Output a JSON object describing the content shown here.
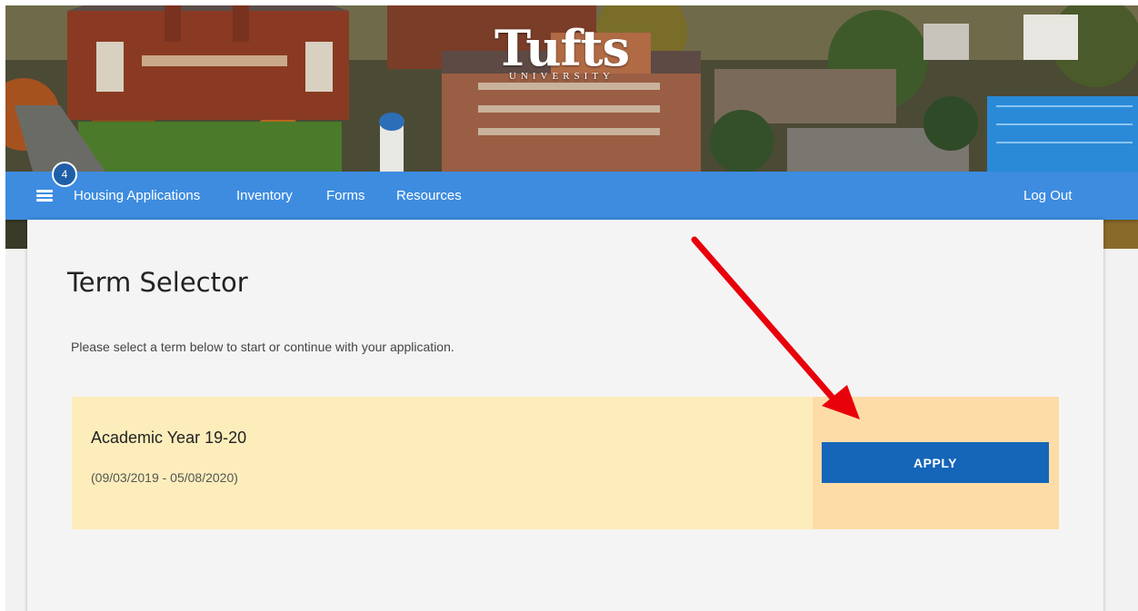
{
  "brand": {
    "name": "Tufts",
    "subtitle": "UNIVERSITY"
  },
  "nav": {
    "badge_count": "4",
    "items": [
      {
        "label": "Housing Applications"
      },
      {
        "label": "Inventory"
      },
      {
        "label": "Forms"
      },
      {
        "label": "Resources"
      }
    ],
    "logout_label": "Log Out",
    "menu_icon": "hamburger-icon"
  },
  "page": {
    "title": "Term Selector",
    "intro": "Please select a term below to start or continue with your application."
  },
  "terms": [
    {
      "name": "Academic Year 19-20",
      "dates": "(09/03/2019 - 05/08/2020)",
      "button_label": "APPLY"
    }
  ],
  "colors": {
    "nav_bar": "#3d8ce0",
    "badge": "#1f5fa8",
    "term_bg": "#fdedbb",
    "term_action_bg": "#fddca7",
    "apply_button": "#1565b8",
    "annotation_arrow": "#e8000b"
  },
  "annotation": {
    "type": "arrow",
    "points_to": "apply-button"
  }
}
